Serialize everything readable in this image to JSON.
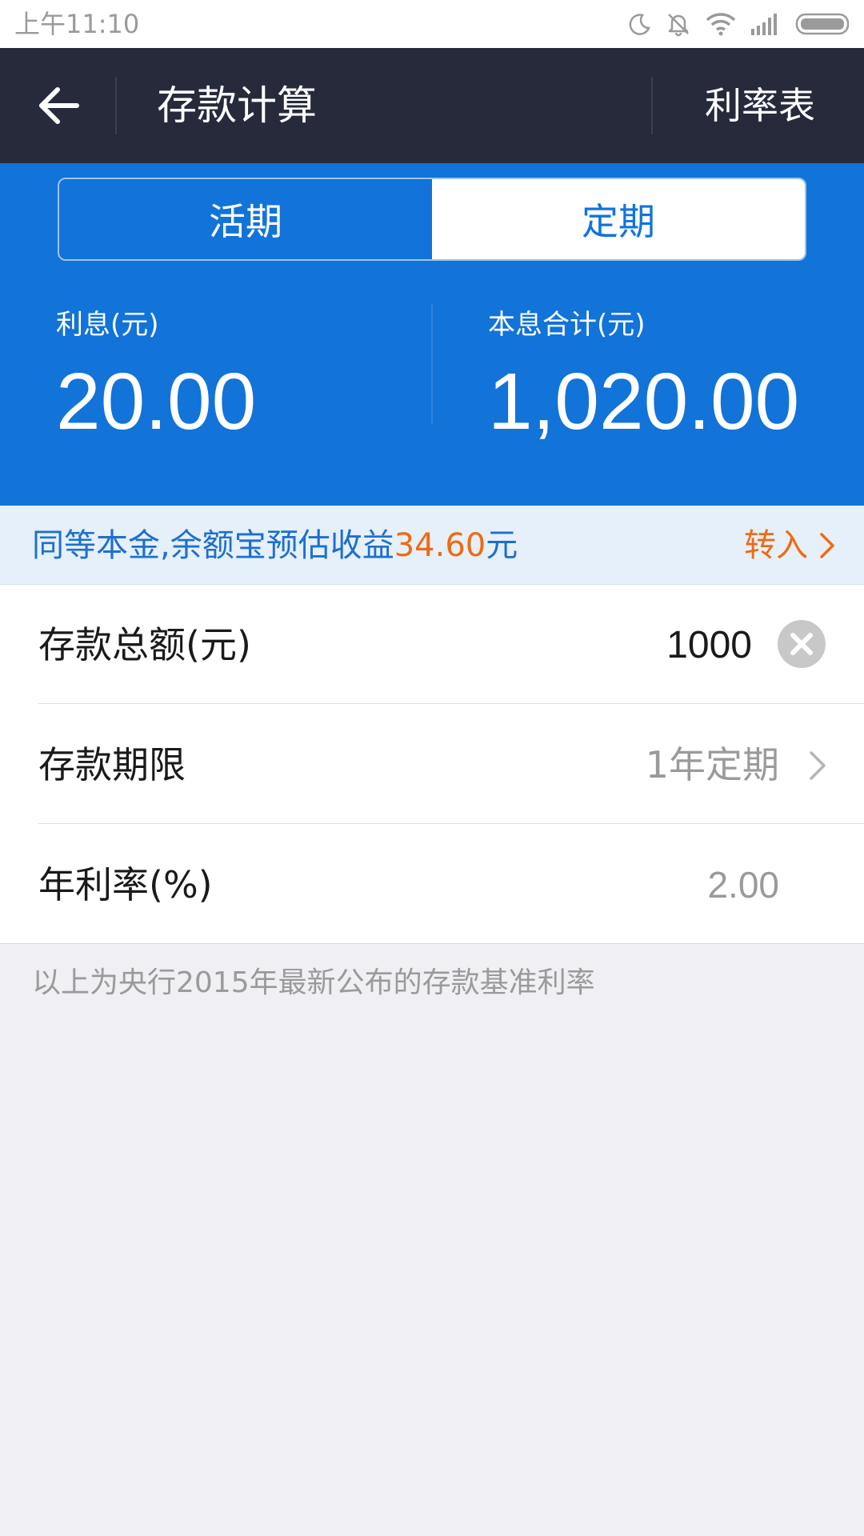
{
  "status_bar": {
    "time": "上午11:10",
    "icons": [
      "moon-icon",
      "bell-muted-icon",
      "wifi-icon",
      "signal-icon",
      "battery-icon"
    ]
  },
  "nav": {
    "back_icon": "arrow-left-icon",
    "title": "存款计算",
    "rate_table_label": "利率表"
  },
  "tabs": [
    {
      "label": "活期",
      "selected": false
    },
    {
      "label": "定期",
      "selected": true
    }
  ],
  "results": {
    "interest_label": "利息(元)",
    "interest_value": "20.00",
    "total_label": "本息合计(元)",
    "total_value": "1,020.00"
  },
  "banner": {
    "text_prefix": "同等本金,余额宝预估收益",
    "highlight_amount": "34.60",
    "text_suffix": "元",
    "action_label": "转入"
  },
  "form": {
    "amount": {
      "label": "存款总额(元)",
      "value": "1000"
    },
    "term": {
      "label": "存款期限",
      "value": "1年定期"
    },
    "rate": {
      "label": "年利率(%)",
      "value": "2.00"
    }
  },
  "footnote": "以上为央行2015年最新公布的存款基准利率",
  "colors": {
    "nav_bg": "#262a3b",
    "primary_blue": "#1273d9",
    "accent_orange": "#f06a12",
    "banner_bg": "#e6f0fa",
    "page_bg": "#efeff4"
  }
}
